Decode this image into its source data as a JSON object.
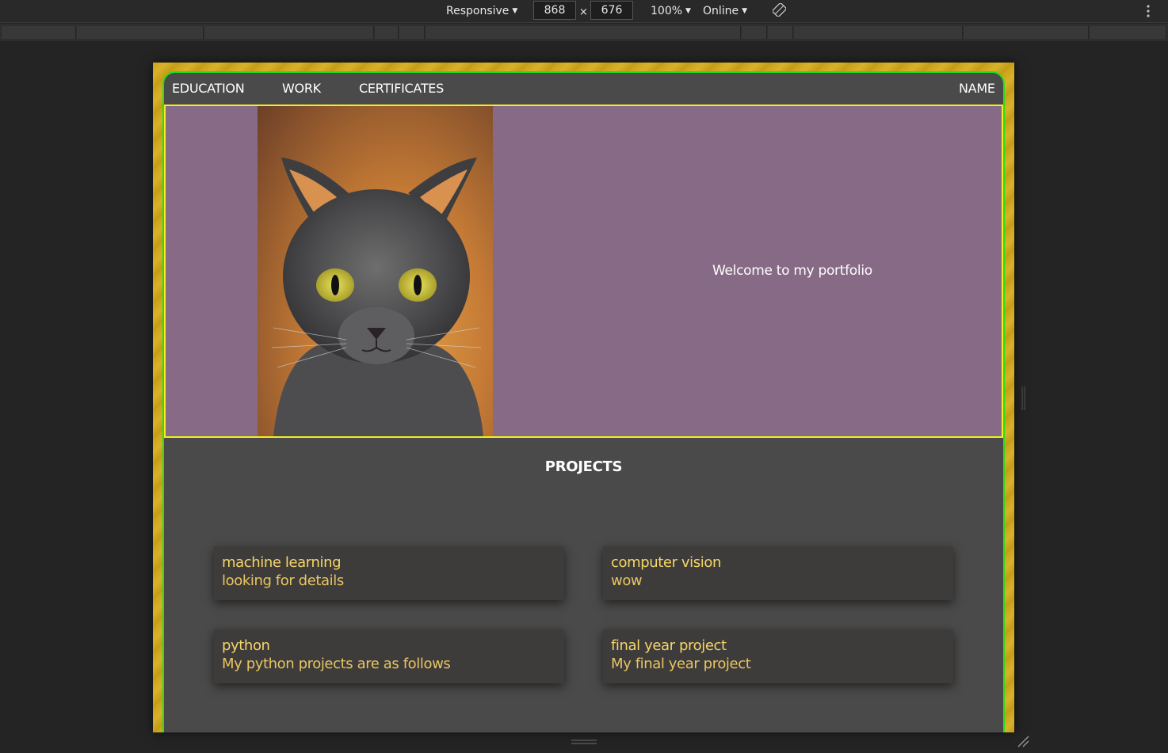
{
  "devtools": {
    "device_mode": "Responsive",
    "width_value": "868",
    "times_symbol": "×",
    "height_value": "676",
    "zoom": "100%",
    "network": "Online",
    "caret": "▼"
  },
  "site": {
    "nav": {
      "education": "EDUCATION",
      "work": "WORK",
      "certificates": "CERTIFICATES",
      "name": "NAME"
    },
    "hero": {
      "welcome": "Welcome to my portfolio"
    },
    "projects": {
      "title": "PROJECTS",
      "cards": [
        {
          "title": "machine learning",
          "desc": "looking for details"
        },
        {
          "title": "computer vision",
          "desc": "wow"
        },
        {
          "title": "python",
          "desc": "My python projects are as follows"
        },
        {
          "title": "final year project",
          "desc": "My final year project"
        }
      ]
    }
  },
  "colors": {
    "page_bg": "#4a4a4a",
    "hero_bg": "#876a85",
    "hero_border": "#f0f01e",
    "page_border": "#22e01a",
    "card_bg": "#3e3b3b",
    "card_text": "#f5d66a",
    "viewport_bg": "#c9a21c"
  }
}
